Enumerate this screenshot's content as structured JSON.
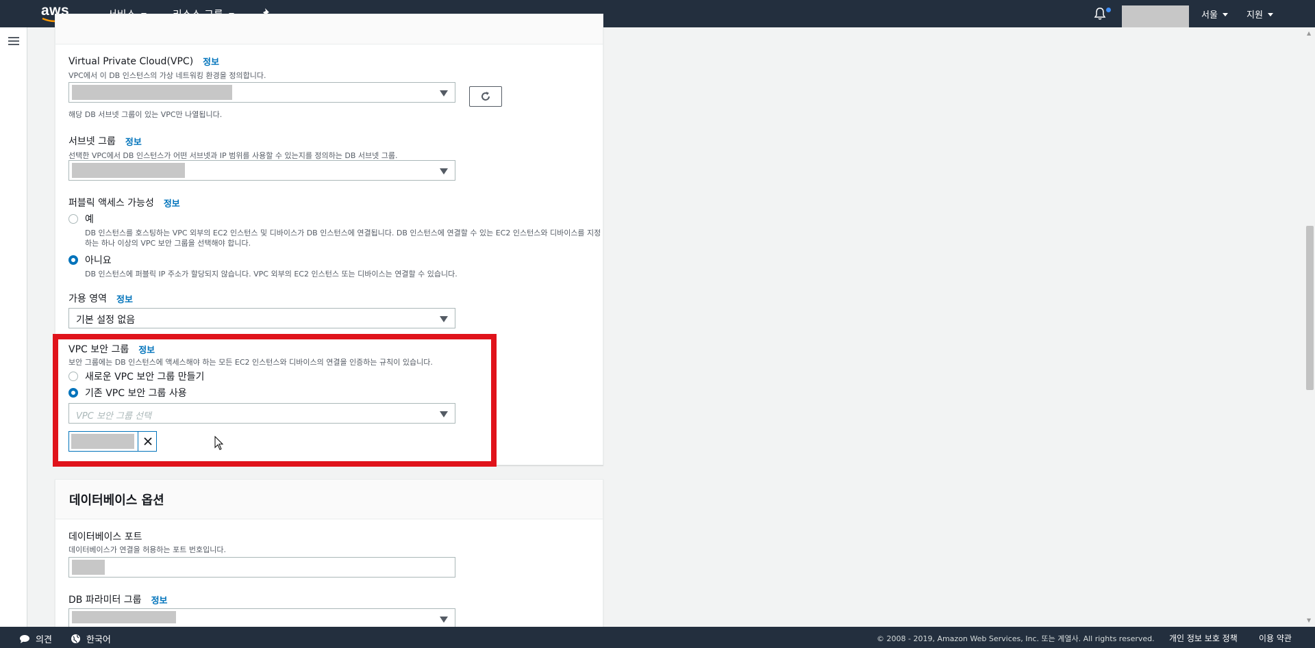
{
  "topnav": {
    "logo_text": "aws",
    "services": "서비스",
    "resource_groups": "리소스 그룹",
    "region": "서울",
    "support": "지원"
  },
  "connectivity": {
    "vpc": {
      "label": "Virtual Private Cloud(VPC)",
      "info": "정보",
      "desc": "VPC에서 이 DB 인스턴스의 가상 네트워킹 환경을 정의합니다.",
      "note": "해당 DB 서브넷 그룹이 있는 VPC만 나열됩니다."
    },
    "subnet": {
      "label": "서브넷 그룹",
      "info": "정보",
      "desc": "선택한 VPC에서 DB 인스턴스가 어떤 서브넷과 IP 범위를 사용할 수 있는지를 정의하는 DB 서브넷 그룹."
    },
    "public_access": {
      "label": "퍼블릭 액세스 가능성",
      "info": "정보",
      "yes_label": "예",
      "yes_desc": "DB 인스턴스를 호스팅하는 VPC 외부의 EC2 인스턴스 및 디바이스가 DB 인스턴스에 연결됩니다. DB 인스턴스에 연결할 수 있는 EC2 인스턴스와 디바이스를 지정하는 하나 이상의 VPC 보안 그룹을 선택해야 합니다.",
      "no_label": "아니요",
      "no_desc": "DB 인스턴스에 퍼블릭 IP 주소가 할당되지 않습니다. VPC 외부의 EC2 인스턴스 또는 디바이스는 연결할 수 있습니다.",
      "selected": "아니요"
    },
    "az": {
      "label": "가용 영역",
      "info": "정보",
      "value": "기본 설정 없음"
    },
    "security_group": {
      "label": "VPC 보안 그룹",
      "info": "정보",
      "desc": "보안 그룹에는 DB 인스턴스에 액세스해야 하는 모든 EC2 인스턴스와 디바이스의 연결을 인증하는 규칙이 있습니다.",
      "new_label": "새로운 VPC 보안 그룹 만들기",
      "existing_label": "기존 VPC 보안 그룹 사용",
      "selected": "기존 VPC 보안 그룹 사용",
      "placeholder": "VPC 보안 그룹 선택"
    }
  },
  "db_options": {
    "title": "데이터베이스 옵션",
    "port": {
      "label": "데이터베이스 포트",
      "desc": "데이터베이스가 연결을 허용하는 포트 번호입니다."
    },
    "param_group": {
      "label": "DB 파라미터 그룹",
      "info": "정보"
    }
  },
  "footer": {
    "feedback": "의견",
    "language": "한국어",
    "copyright": "© 2008 - 2019, Amazon Web Services, Inc. 또는 계열사. All rights reserved.",
    "privacy": "개인 정보 보호 정책",
    "terms": "이용 약관"
  },
  "colors": {
    "nav_bg": "#232f3e",
    "link": "#0073bb",
    "highlight": "#e0131b"
  }
}
